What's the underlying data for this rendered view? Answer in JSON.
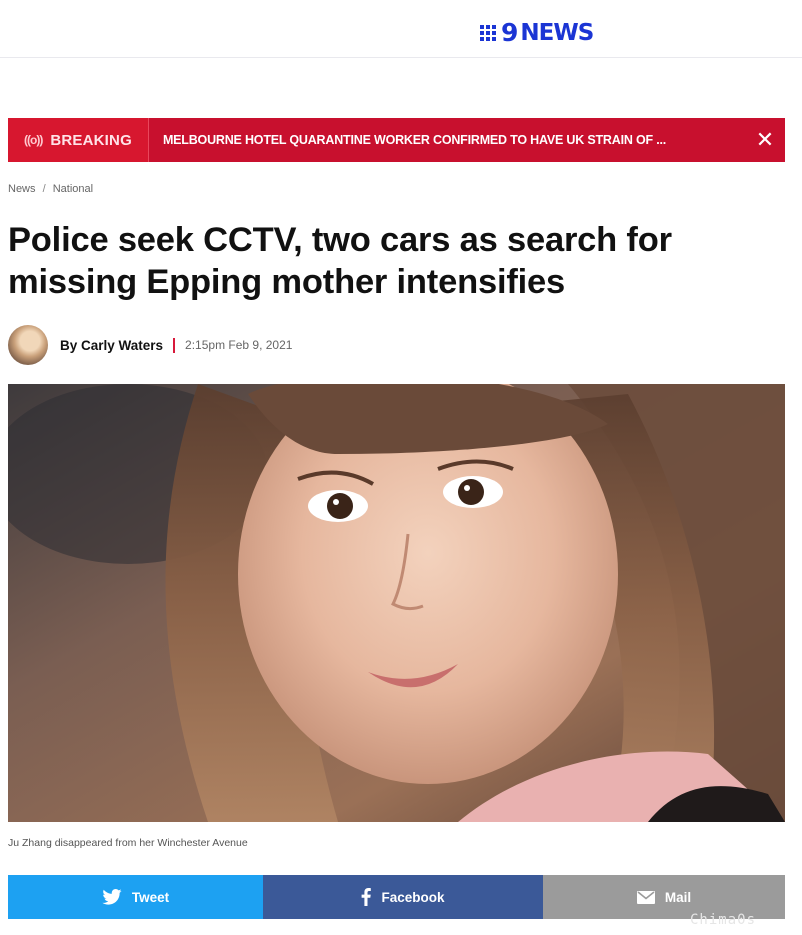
{
  "header": {
    "logo_text": "NEWS",
    "logo_numeral": "9"
  },
  "breaking": {
    "label": "BREAKING",
    "headline": "MELBOURNE HOTEL QUARANTINE WORKER CONFIRMED TO HAVE UK STRAIN OF ...",
    "close_symbol": "✕",
    "radio_icon": "((o))"
  },
  "breadcrumb": {
    "section": "News",
    "separator": "/",
    "subsection": "National"
  },
  "article": {
    "title": "Police seek CCTV, two cars as search for missing Epping mother intensifies",
    "author": "By Carly Waters",
    "timestamp": "2:15pm Feb 9, 2021",
    "image_caption": "Ju Zhang disappeared from her Winchester Avenue"
  },
  "share": {
    "tweet_label": "Tweet",
    "facebook_label": "Facebook",
    "mail_label": "Mail"
  },
  "watermark": "Chima0s",
  "colors": {
    "brand_blue": "#1b35d4",
    "breaking_red": "#c8102e",
    "twitter": "#1da1f2",
    "facebook": "#3b5998",
    "mail": "#9b9b9b"
  }
}
